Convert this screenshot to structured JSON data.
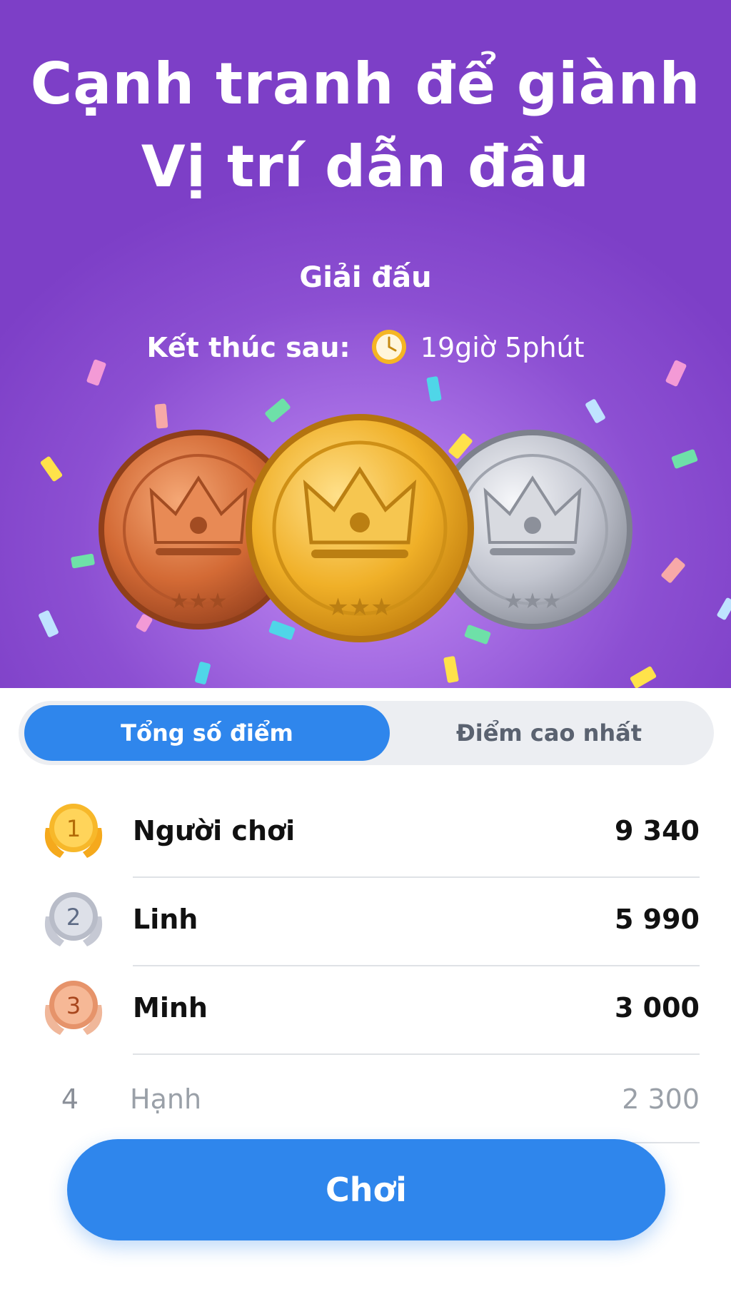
{
  "hero": {
    "headline_line1": "Cạnh tranh để giành",
    "headline_line2": "Vị trí dẫn đầu",
    "subtitle": "Giải đấu",
    "timer_label": "Kết thúc sau:",
    "timer_value": "19giờ 5phút"
  },
  "tabs": {
    "total": "Tổng số điểm",
    "best": "Điểm cao nhất",
    "active": "total"
  },
  "leaderboard": [
    {
      "rank": "1",
      "name": "Người chơi",
      "score": "9 340"
    },
    {
      "rank": "2",
      "name": "Linh",
      "score": "5 990"
    },
    {
      "rank": "3",
      "name": "Minh",
      "score": "3 000"
    },
    {
      "rank": "4",
      "name": "Hạnh",
      "score": "2 300"
    }
  ],
  "play_button": "Chơi",
  "colors": {
    "primary_blue": "#2f86ec",
    "hero_purple": "#8c4fd2",
    "gold": "#f2b01e",
    "silver": "#c9ccd6",
    "bronze": "#e08a5c"
  },
  "icons": [
    "clock-icon",
    "bronze-medal-icon",
    "gold-medal-icon",
    "silver-medal-icon",
    "laurel-badge-icon"
  ]
}
